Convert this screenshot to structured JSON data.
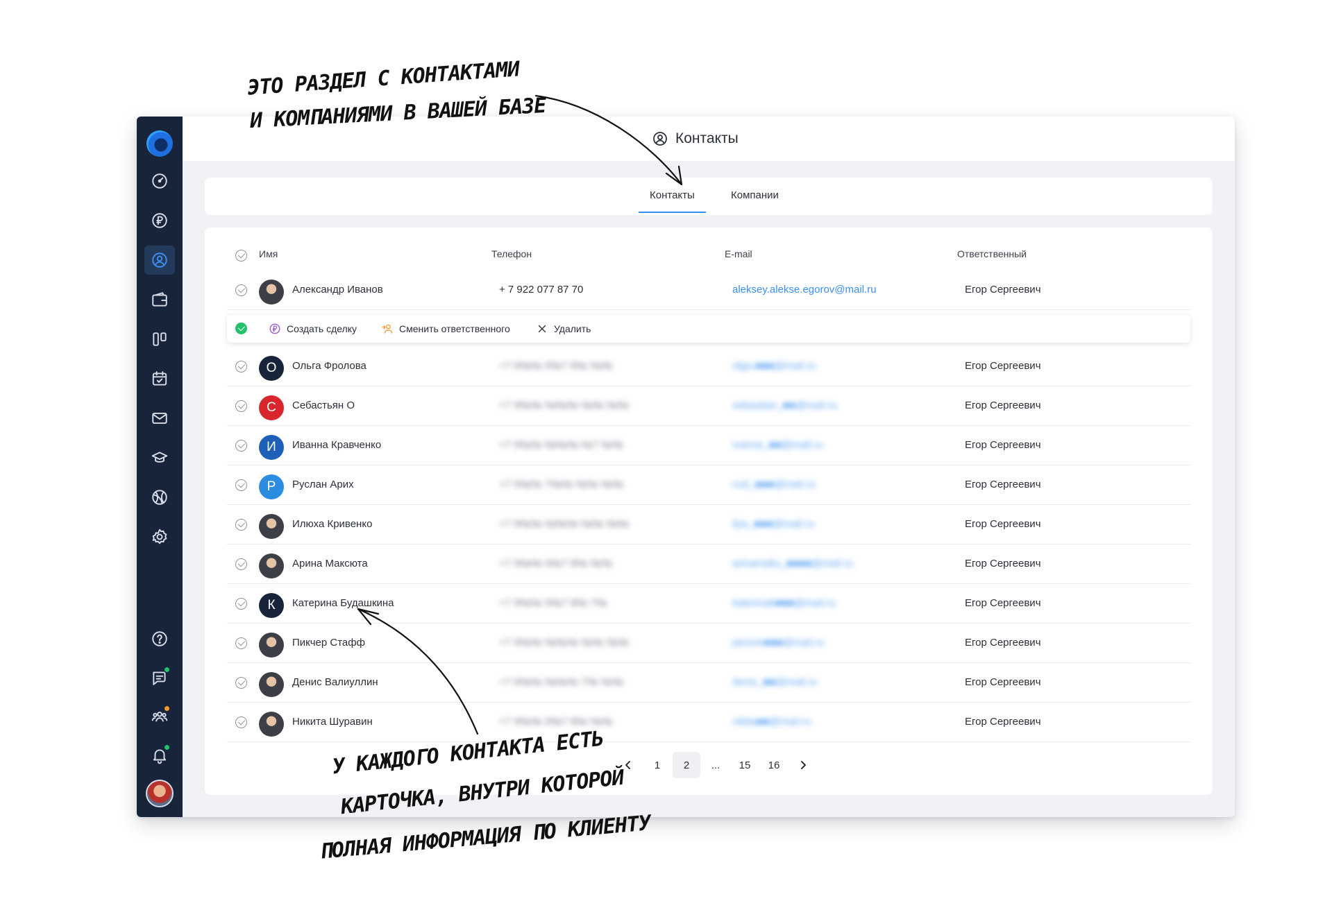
{
  "annotations": {
    "top_line1": "ЭТО РАЗДЕЛ С КОНТАКТАМИ",
    "top_line2": "И КОМПАНИЯМИ В ВАШЕЙ БАЗЕ",
    "bottom_line1": "У КАЖДОГО КОНТАКТА ЕСТЬ",
    "bottom_line2": "КАРТОЧКА, ВНУТРИ КОТОРОЙ",
    "bottom_line3": "ПОЛНАЯ ИНФОРМАЦИЯ ПО КЛИЕНТУ"
  },
  "sidebar": {
    "items": [
      {
        "icon": "dashboard-icon"
      },
      {
        "icon": "ruble-icon"
      },
      {
        "icon": "contacts-icon",
        "active": true
      },
      {
        "icon": "wallet-icon"
      },
      {
        "icon": "kanban-icon"
      },
      {
        "icon": "calendar-icon"
      },
      {
        "icon": "mail-icon"
      },
      {
        "icon": "education-icon"
      },
      {
        "icon": "integrations-icon"
      },
      {
        "icon": "settings-icon"
      }
    ],
    "bottom": [
      "help-icon",
      "chat-icon",
      "team-icon",
      "bell-icon"
    ]
  },
  "header": {
    "title": "Контакты"
  },
  "tabs": [
    {
      "label": "Контакты",
      "active": true
    },
    {
      "label": "Компании",
      "active": false
    }
  ],
  "table": {
    "columns": {
      "name": "Имя",
      "phone": "Телефон",
      "email": "E-mail",
      "responsible": "Ответственный"
    },
    "first_row": {
      "name": "Александр Иванов",
      "phone": "+ 7 922 077 87 70",
      "email": "aleksey.alekse.egorov@mail.ru",
      "responsible": "Егор Сергеевич"
    },
    "actions": {
      "create_deal": "Создать сделку",
      "change_responsible": "Сменить ответственного",
      "delete": "Удалить"
    },
    "rows": [
      {
        "initial": "О",
        "color": "#17243a",
        "name": "Ольга Фролова",
        "phone": "+7 9№№ 0№7 8№ №№",
        "email": "olga.■■■@mail.ru",
        "responsible": "Егор Сергеевич"
      },
      {
        "initial": "С",
        "color": "#d8262c",
        "name": "Себастьян О",
        "phone": "+7 9№№ №№№ №№ №№",
        "email": "sebastian_■■@mail.ru",
        "responsible": "Егор Сергеевич"
      },
      {
        "initial": "И",
        "color": "#1e5fb8",
        "name": "Иванна Кравченко",
        "phone": "+7 9№№ №№№ №7 №№",
        "email": "ivanna_■■@mail.ru",
        "responsible": "Егор Сергеевич"
      },
      {
        "initial": "Р",
        "color": "#2c8de0",
        "name": "Руслан Арих",
        "phone": "+7 9№№ 7№№ №№ №№",
        "email": "rusl_■■■@mail.ru",
        "responsible": "Егор Сергеевич"
      },
      {
        "initial": "",
        "color": "",
        "name": "Илюха Кривенко",
        "phone": "+7 9№№ №№№ №№ №№",
        "email": "ilya_■■■@mail.ru",
        "responsible": "Егор Сергеевич"
      },
      {
        "initial": "",
        "color": "",
        "name": "Арина Максюта",
        "phone": "+7 9№№ 0№7 8№ №№",
        "email": "arinamaks_■■■■@mail.ru",
        "responsible": "Егор Сергеевич"
      },
      {
        "initial": "К",
        "color": "#17243a",
        "name": "Катерина Будашкина",
        "phone": "+7 9№№ 0№7 8№ 7№",
        "email": "katerinab■■■@mail.ru",
        "responsible": "Егор Сергеевич"
      },
      {
        "initial": "",
        "color": "",
        "name": "Пикчер Стафф",
        "phone": "+7 9№№ №№№ №№ №№",
        "email": "picture■■■@mail.ru",
        "responsible": "Егор Сергеевич"
      },
      {
        "initial": "",
        "color": "",
        "name": "Денис Валиуллин",
        "phone": "+7 9№№ №№№ 7№ №№",
        "email": "denis_■■@mail.ru",
        "responsible": "Егор Сергеевич"
      },
      {
        "initial": "",
        "color": "",
        "name": "Никита Шуравин",
        "phone": "+7 9№№ 0№7 8№ №№",
        "email": "nikita■■@mail.ru",
        "responsible": "Егор Сергеевич"
      }
    ]
  },
  "pagination": {
    "pages": [
      "1",
      "2",
      "...",
      "15",
      "16"
    ],
    "current": "2"
  }
}
